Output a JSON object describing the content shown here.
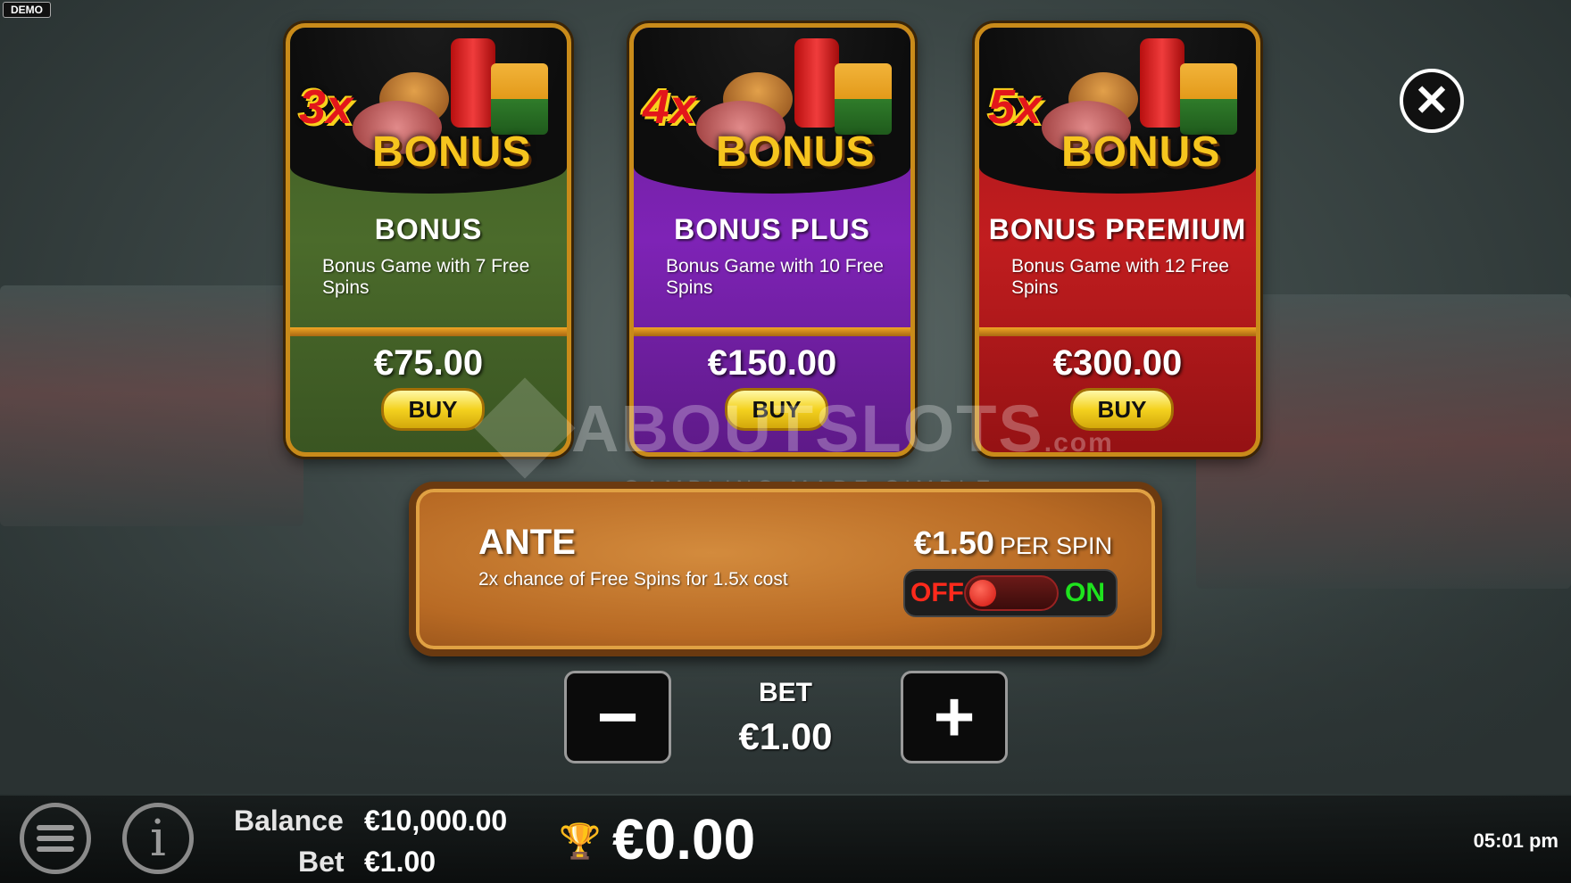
{
  "demo_badge": "DEMO",
  "close_icon": "close-icon",
  "cards": [
    {
      "multiplier": "3x",
      "art_label": "BONUS",
      "title": "BONUS",
      "description": "Bonus Game with 7 Free Spins",
      "price": "€75.00",
      "buy_label": "BUY",
      "color": "#4b6b2b"
    },
    {
      "multiplier": "4x",
      "art_label": "BONUS",
      "title": "BONUS PLUS",
      "description": "Bonus Game with 10 Free Spins",
      "price": "€150.00",
      "buy_label": "BUY",
      "color": "#7e23b6"
    },
    {
      "multiplier": "5x",
      "art_label": "BONUS",
      "title": "BONUS PREMIUM",
      "description": "Bonus Game with 12 Free Spins",
      "price": "€300.00",
      "buy_label": "BUY",
      "color": "#c11d1f"
    }
  ],
  "watermark": {
    "brand": "ABOUTSLOTS",
    "suffix": ".com",
    "tagline": "GAMBLING MADE SIMPLE"
  },
  "ante": {
    "title": "ANTE",
    "description": "2x chance of Free Spins for 1.5x cost",
    "price": "€1.50",
    "per_label": "PER SPIN",
    "toggle_off": "OFF",
    "toggle_on": "ON",
    "toggle_state": "off"
  },
  "bet": {
    "label": "BET",
    "value": "€1.00",
    "minus": "−",
    "plus": "+"
  },
  "footer": {
    "balance_label": "Balance",
    "balance_value": "€10,000.00",
    "bet_label": "Bet",
    "bet_value": "€1.00",
    "win_value": "€0.00",
    "info_glyph": "i",
    "time": "05:01 pm"
  },
  "colors": {
    "accent_gold": "#f6c51e",
    "toggle_off": "#ff2a1c",
    "toggle_on": "#1ee31e"
  }
}
